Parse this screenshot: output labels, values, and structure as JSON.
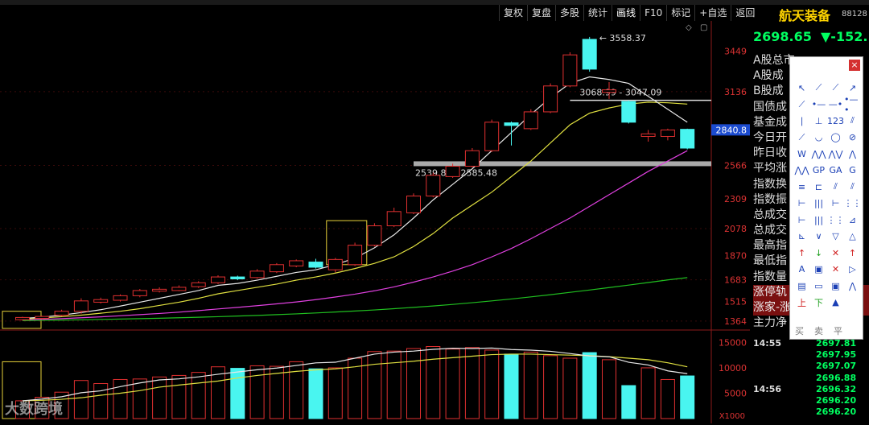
{
  "toolbar": [
    "复权",
    "复盘",
    "多股",
    "统计",
    "画线",
    "F10",
    "标记",
    "+自选",
    "返回"
  ],
  "stock": {
    "name": "航天装备",
    "code": "88128",
    "price": "2698.65",
    "change": "▼-152."
  },
  "info_rows": [
    "A股总市",
    "A股成",
    "B股成",
    "国债成",
    "基金成",
    "今日开",
    "昨日收",
    "平均涨",
    "指数换",
    "指数振",
    "总成交",
    "总成交",
    "最高指",
    "最低指",
    "指数量",
    "涨停轨",
    "涨家-涨",
    "主力净"
  ],
  "price_axis": {
    "labels": [
      "3449",
      "3136",
      "2841",
      "2566",
      "2309",
      "2078",
      "1870",
      "1683",
      "1515",
      "1364"
    ],
    "current_label": "2840.8"
  },
  "volume_axis": {
    "labels": [
      "15000",
      "10000",
      "5000"
    ],
    "unit": "X1000"
  },
  "annotations": {
    "high": "3558.37",
    "upper_range": "3068.99 - 3047.09",
    "lower_range": "2539.84 - 2585.48"
  },
  "ticks": [
    {
      "time": "14:55",
      "price": "2697.81"
    },
    {
      "time": "",
      "price": "2697.95"
    },
    {
      "time": "",
      "price": "2697.07"
    },
    {
      "time": "",
      "price": "2696.88"
    },
    {
      "time": "14:56",
      "price": "2696.32"
    },
    {
      "time": "",
      "price": "2696.20"
    },
    {
      "time": "",
      "price": "2696.20"
    }
  ],
  "palette": {
    "close": "×",
    "tools": [
      "↖",
      "⟋",
      "⟋",
      "↗",
      "⟋",
      "•—",
      "—•",
      "•—•",
      "∣",
      "⊥",
      "123",
      "⫽",
      "⟋",
      "◡",
      "◯",
      "⊘",
      "W",
      "⋀⋀",
      "⋀⋁",
      "⋀",
      "⋀⋀",
      "GP",
      "GA",
      "G",
      "≡",
      "⊏",
      "⫽",
      "⫽",
      "⊢",
      "|||",
      "⊢",
      "⋮⋮",
      "⊢",
      "|||",
      "⋮⋮",
      "⊿",
      "⊾",
      "∨",
      "▽",
      "△",
      "↑",
      "↓",
      "✕",
      "↑",
      "A",
      "▣",
      "✕",
      "▷",
      "▤",
      "▭",
      "▣",
      "⋀",
      "上",
      "下",
      "▲"
    ],
    "bottom_labels": [
      "买",
      "卖",
      "平"
    ]
  },
  "watermark": "大数跨境",
  "colors": {
    "up": "#e03030",
    "down": "#49f5f0",
    "ma5": "#e8e8e8",
    "ma10": "#e0e040",
    "ma20": "#e040e0",
    "ma60": "#20c020",
    "name": "#ffd400",
    "price": "#00ff60"
  },
  "chart_data": {
    "type": "candlestick",
    "candles": [
      {
        "o": 1375,
        "c": 1392,
        "h": 1398,
        "l": 1368
      },
      {
        "o": 1385,
        "c": 1400,
        "h": 1405,
        "l": 1378
      },
      {
        "o": 1410,
        "c": 1440,
        "h": 1452,
        "l": 1402
      },
      {
        "o": 1440,
        "c": 1520,
        "h": 1540,
        "l": 1420
      },
      {
        "o": 1510,
        "c": 1530,
        "h": 1545,
        "l": 1500
      },
      {
        "o": 1525,
        "c": 1560,
        "h": 1570,
        "l": 1515
      },
      {
        "o": 1560,
        "c": 1600,
        "h": 1612,
        "l": 1548
      },
      {
        "o": 1595,
        "c": 1610,
        "h": 1625,
        "l": 1585
      },
      {
        "o": 1600,
        "c": 1625,
        "h": 1640,
        "l": 1595
      },
      {
        "o": 1630,
        "c": 1660,
        "h": 1672,
        "l": 1620
      },
      {
        "o": 1660,
        "c": 1705,
        "h": 1718,
        "l": 1650
      },
      {
        "o": 1705,
        "c": 1690,
        "h": 1715,
        "l": 1680
      },
      {
        "o": 1700,
        "c": 1750,
        "h": 1765,
        "l": 1692
      },
      {
        "o": 1745,
        "c": 1800,
        "h": 1812,
        "l": 1735
      },
      {
        "o": 1790,
        "c": 1830,
        "h": 1840,
        "l": 1780
      },
      {
        "o": 1820,
        "c": 1780,
        "h": 1845,
        "l": 1770
      },
      {
        "o": 1760,
        "c": 1840,
        "h": 1852,
        "l": 1740
      },
      {
        "o": 1800,
        "c": 1950,
        "h": 1970,
        "l": 1790
      },
      {
        "o": 1950,
        "c": 2100,
        "h": 2120,
        "l": 1940
      },
      {
        "o": 2100,
        "c": 2210,
        "h": 2240,
        "l": 2090
      },
      {
        "o": 2200,
        "c": 2330,
        "h": 2350,
        "l": 2190
      },
      {
        "o": 2330,
        "c": 2490,
        "h": 2510,
        "l": 2320
      },
      {
        "o": 2480,
        "c": 2560,
        "h": 2580,
        "l": 2470
      },
      {
        "o": 2560,
        "c": 2680,
        "h": 2700,
        "l": 2550
      },
      {
        "o": 2680,
        "c": 2900,
        "h": 2920,
        "l": 2670
      },
      {
        "o": 2895,
        "c": 2875,
        "h": 2905,
        "l": 2720
      },
      {
        "o": 2850,
        "c": 2980,
        "h": 3000,
        "l": 2840
      },
      {
        "o": 2980,
        "c": 3180,
        "h": 3200,
        "l": 2970
      },
      {
        "o": 3180,
        "c": 3420,
        "h": 3440,
        "l": 3170
      },
      {
        "o": 3540,
        "c": 3310,
        "h": 3558.37,
        "l": 3290
      },
      {
        "o": 3130,
        "c": 3150,
        "h": 3210,
        "l": 3080
      },
      {
        "o": 3060,
        "c": 2900,
        "h": 3068.99,
        "l": 2890
      },
      {
        "o": 2790,
        "c": 2810,
        "h": 2840,
        "l": 2750
      },
      {
        "o": 2790,
        "c": 2840,
        "h": 2850,
        "l": 2760
      },
      {
        "o": 2845,
        "c": 2700,
        "h": 2850,
        "l": 2690
      }
    ],
    "volumes": [
      3500,
      4200,
      5200,
      7500,
      6900,
      7700,
      7800,
      8200,
      8500,
      9100,
      10200,
      9900,
      10400,
      10300,
      11200,
      9800,
      10000,
      11900,
      13200,
      13300,
      13800,
      14200,
      13700,
      14000,
      13500,
      12700,
      13100,
      12400,
      11900,
      13000,
      11600,
      6500,
      10000,
      7700,
      8400
    ],
    "ma5": [
      1385,
      1395,
      1410,
      1430,
      1452,
      1480,
      1510,
      1540,
      1570,
      1600,
      1640,
      1655,
      1680,
      1710,
      1740,
      1760,
      1800,
      1850,
      1930,
      2030,
      2160,
      2300,
      2420,
      2540,
      2680,
      2820,
      2960,
      3090,
      3200,
      3250,
      3230,
      3200,
      3100,
      3000,
      2900
    ],
    "ma10": [
      1380,
      1388,
      1398,
      1410,
      1425,
      1440,
      1460,
      1485,
      1510,
      1540,
      1575,
      1600,
      1625,
      1650,
      1680,
      1705,
      1735,
      1770,
      1810,
      1860,
      1940,
      2040,
      2160,
      2260,
      2360,
      2480,
      2600,
      2740,
      2880,
      2970,
      3010,
      3040,
      3055,
      3050,
      3040
    ],
    "ma20": [
      1375,
      1378,
      1383,
      1390,
      1397,
      1405,
      1414,
      1423,
      1433,
      1445,
      1458,
      1470,
      1483,
      1497,
      1512,
      1530,
      1550,
      1572,
      1598,
      1628,
      1665,
      1705,
      1750,
      1800,
      1860,
      1925,
      2000,
      2080,
      2160,
      2250,
      2340,
      2430,
      2520,
      2600,
      2680
    ],
    "ma60": [
      1368,
      1370,
      1372,
      1374,
      1377,
      1380,
      1383,
      1386,
      1390,
      1394,
      1398,
      1403,
      1408,
      1414,
      1420,
      1427,
      1434,
      1442,
      1450,
      1460,
      1470,
      1481,
      1493,
      1506,
      1520,
      1535,
      1551,
      1568,
      1586,
      1604,
      1623,
      1642,
      1662,
      1682,
      1700
    ],
    "vol_ma5": [
      3500,
      3850,
      4300,
      5100,
      5460,
      6300,
      7020,
      7620,
      7820,
      8220,
      8740,
      9180,
      9620,
      9960,
      10460,
      10980,
      11100,
      11900,
      12700,
      13100,
      13300,
      13640,
      13860,
      13800,
      13900,
      13600,
      13480,
      13260,
      12820,
      12340,
      12180,
      11100,
      10560,
      9400,
      8840
    ],
    "vol_ma10": [
      3500,
      3600,
      3800,
      4100,
      4600,
      5000,
      5500,
      6200,
      6600,
      7000,
      7400,
      8000,
      8500,
      8900,
      9300,
      9600,
      9800,
      10200,
      10700,
      11000,
      11300,
      11700,
      12000,
      12300,
      12600,
      12700,
      12700,
      12600,
      12500,
      12400,
      12200,
      11900,
      11600,
      11000,
      10200
    ]
  }
}
